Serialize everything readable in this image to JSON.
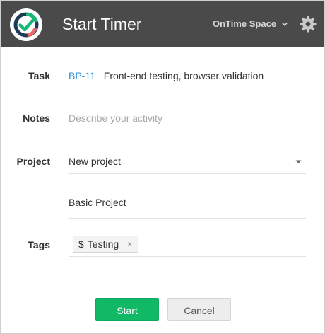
{
  "header": {
    "title": "Start Timer",
    "workspace": "OnTime Space",
    "icons": {
      "logo": "ontime-logo-icon",
      "dropdown": "chevron-down-icon",
      "settings": "gear-icon"
    }
  },
  "form": {
    "task": {
      "label": "Task",
      "id": "BP-11",
      "name": "Front-end testing, browser validation"
    },
    "notes": {
      "label": "Notes",
      "value": "",
      "placeholder": "Describe your activity"
    },
    "project": {
      "label": "Project",
      "selected": "New project",
      "secondary": "Basic Project"
    },
    "tags": {
      "label": "Tags",
      "items": [
        {
          "symbol": "$",
          "label": "Testing",
          "remove": "×"
        }
      ]
    }
  },
  "actions": {
    "start_label": "Start",
    "cancel_label": "Cancel"
  },
  "colors": {
    "header_bg": "#4a4a4a",
    "accent": "#11b866",
    "link": "#2e8fd4"
  }
}
